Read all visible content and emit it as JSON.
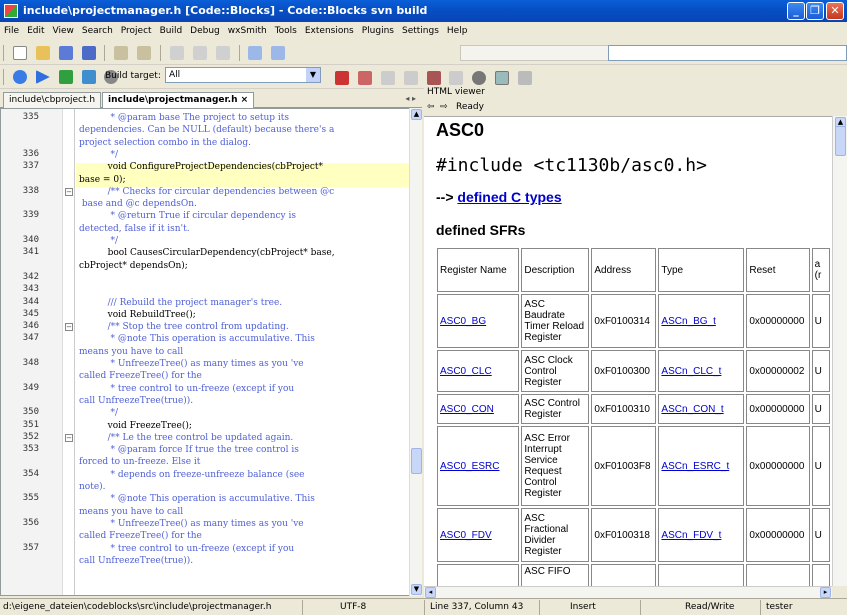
{
  "window": {
    "title": "include\\projectmanager.h [Code::Blocks] - Code::Blocks svn build"
  },
  "menu": [
    "File",
    "Edit",
    "View",
    "Search",
    "Project",
    "Build",
    "Debug",
    "wxSmith",
    "Tools",
    "Extensions",
    "Plugins",
    "Settings",
    "Help"
  ],
  "toolbar": {
    "build_target_label": "Build target:",
    "build_target_value": "All"
  },
  "editor": {
    "tabs": [
      {
        "label": "include\\cbproject.h"
      },
      {
        "label": "include\\projectmanager.h ×"
      }
    ],
    "lines": [
      {
        "n": "335",
        "text": "           * @param base The project to setup its",
        "cls": "cm"
      },
      {
        "n": "",
        "text": "dependencies. Can be NULL (default) because there's a",
        "cls": "cm"
      },
      {
        "n": "",
        "text": "project selection combo in the dialog.",
        "cls": "cm"
      },
      {
        "n": "336",
        "text": "           */",
        "cls": "cm"
      },
      {
        "n": "337",
        "text": "          void ConfigureProjectDependencies(cbProject*",
        "cls": "code"
      },
      {
        "n": "",
        "text": "base = 0);",
        "cls": "code"
      },
      {
        "n": "338",
        "text": "          /** Checks for circular dependencies between @c",
        "cls": "cm"
      },
      {
        "n": "",
        "text": " base and @c dependsOn.",
        "cls": "cm"
      },
      {
        "n": "339",
        "text": "           * @return True if circular dependency is",
        "cls": "cm"
      },
      {
        "n": "",
        "text": "detected, false if it isn't.",
        "cls": "cm"
      },
      {
        "n": "340",
        "text": "           */",
        "cls": "cm"
      },
      {
        "n": "341",
        "text": "          bool CausesCircularDependency(cbProject* base,",
        "cls": "code"
      },
      {
        "n": "",
        "text": "cbProject* dependsOn);",
        "cls": "code"
      },
      {
        "n": "342",
        "text": "",
        "cls": "code"
      },
      {
        "n": "343",
        "text": "",
        "cls": "code"
      },
      {
        "n": "344",
        "text": "          /// Rebuild the project manager's tree.",
        "cls": "cm"
      },
      {
        "n": "345",
        "text": "          void RebuildTree();",
        "cls": "code"
      },
      {
        "n": "346",
        "text": "          /** Stop the tree control from updating.",
        "cls": "cm"
      },
      {
        "n": "347",
        "text": "           * @note This operation is accumulative. This",
        "cls": "cm"
      },
      {
        "n": "",
        "text": "means you have to call",
        "cls": "cm"
      },
      {
        "n": "348",
        "text": "           * UnfreezeTree() as many times as you 've",
        "cls": "cm"
      },
      {
        "n": "",
        "text": "called FreezeTree() for the",
        "cls": "cm"
      },
      {
        "n": "349",
        "text": "           * tree control to un-freeze (except if you",
        "cls": "cm"
      },
      {
        "n": "",
        "text": "call UnfreezeTree(true)).",
        "cls": "cm"
      },
      {
        "n": "350",
        "text": "           */",
        "cls": "cm"
      },
      {
        "n": "351",
        "text": "          void FreezeTree();",
        "cls": "code"
      },
      {
        "n": "352",
        "text": "          /** Le the tree control be updated again.",
        "cls": "cm"
      },
      {
        "n": "353",
        "text": "           * @param force If true the tree control is",
        "cls": "cm"
      },
      {
        "n": "",
        "text": "forced to un-freeze. Else it",
        "cls": "cm"
      },
      {
        "n": "354",
        "text": "           * depends on freeze-unfreeze balance (see",
        "cls": "cm"
      },
      {
        "n": "",
        "text": "note).",
        "cls": "cm"
      },
      {
        "n": "355",
        "text": "           * @note This operation is accumulative. This",
        "cls": "cm"
      },
      {
        "n": "",
        "text": "means you have to call",
        "cls": "cm"
      },
      {
        "n": "356",
        "text": "           * UnfreezeTree() as many times as you 've",
        "cls": "cm"
      },
      {
        "n": "",
        "text": "called FreezeTree() for the",
        "cls": "cm"
      },
      {
        "n": "357",
        "text": "           * tree control to un-freeze (except if you",
        "cls": "cm"
      },
      {
        "n": "",
        "text": "call UnfreezeTree(true)).",
        "cls": "cm"
      }
    ]
  },
  "html_viewer": {
    "title": "HTML viewer",
    "nav_ready": "Ready",
    "heading": "ASC0",
    "include": "#include <tc1130b/asc0.h>",
    "arrow": "-->",
    "defined_c_types": "defined C types",
    "defined_sfrs": "defined SFRs",
    "columns": [
      "Register Name",
      "Description",
      "Address",
      "Type",
      "Reset",
      "a (r"
    ],
    "rows": [
      {
        "name": "ASC0_BG",
        "desc": "ASC Baudrate Timer Reload Register",
        "addr": "0xF0100314",
        "type": "ASCn_BG_t",
        "reset": "0x00000000",
        "extra": "U"
      },
      {
        "name": "ASC0_CLC",
        "desc": "ASC Clock Control Register",
        "addr": "0xF0100300",
        "type": "ASCn_CLC_t",
        "reset": "0x00000002",
        "extra": "U"
      },
      {
        "name": "ASC0_CON",
        "desc": "ASC Control Register",
        "addr": "0xF0100310",
        "type": "ASCn_CON_t",
        "reset": "0x00000000",
        "extra": "U"
      },
      {
        "name": "ASC0_ESRC",
        "desc": "ASC Error Interrupt Service Request Control Register",
        "addr": "0xF01003F8",
        "type": "ASCn_ESRC_t",
        "reset": "0x00000000",
        "extra": "U"
      },
      {
        "name": "ASC0_FDV",
        "desc": "ASC Fractional Divider Register",
        "addr": "0xF0100318",
        "type": "ASCn_FDV_t",
        "reset": "0x00000000",
        "extra": "U"
      },
      {
        "name": "",
        "desc": "ASC FIFO",
        "addr": "",
        "type": "",
        "reset": "",
        "extra": ""
      }
    ]
  },
  "status": {
    "path": "d:\\eigene_dateien\\codeblocks\\src\\include\\projectmanager.h",
    "encoding": "UTF-8",
    "position": "Line 337, Column 43",
    "mode": "Insert",
    "access": "Read/Write",
    "user": "tester"
  }
}
